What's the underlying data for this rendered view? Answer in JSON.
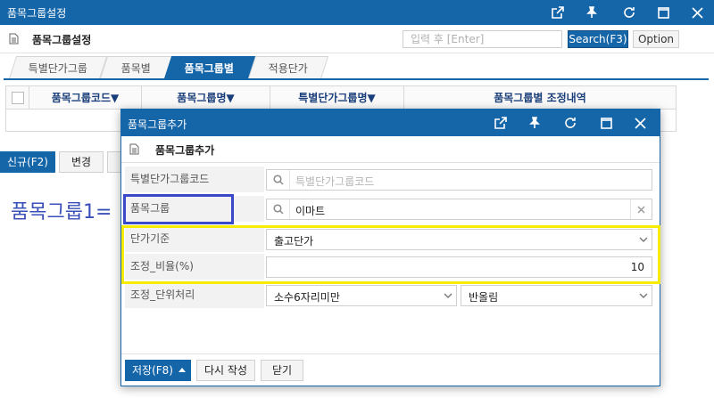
{
  "window": {
    "title": "품목그룹설정",
    "header_title": "품목그룹설정",
    "search": {
      "placeholder": "입력 후 [Enter]",
      "value": ""
    },
    "search_button": "Search(F3)",
    "option_button": "Option"
  },
  "tabs": [
    {
      "label": "특별단가그룹",
      "active": false
    },
    {
      "label": "품목별",
      "active": false
    },
    {
      "label": "품목그룹별",
      "active": true
    },
    {
      "label": "적용단가",
      "active": false
    }
  ],
  "grid": {
    "columns": [
      "품목그룹코드▼",
      "품목그룹명▼",
      "특별단가그룹명▼",
      "품목그룹별 조정내역"
    ]
  },
  "main_buttons": {
    "new": "신규(F2)",
    "edit": "변경"
  },
  "overlay_text": "품목그룹1=",
  "modal": {
    "title": "품목그룹추가",
    "header_title": "품목그룹추가",
    "fields": [
      {
        "label": "특별단가그룹코드",
        "placeholder": "특별단가그룹코드",
        "value": ""
      },
      {
        "label": "품목그룹",
        "value": "이마트"
      },
      {
        "label": "단가기준",
        "value": "출고단가"
      },
      {
        "label": "조정_비율(%)",
        "value": "10"
      },
      {
        "label": "조정_단위처리",
        "value": "소수6자리미만",
        "value2": "반올림"
      }
    ],
    "footer": {
      "save": "저장(F8)",
      "rewrite": "다시 작성",
      "close": "닫기"
    }
  },
  "icons": {
    "window_controls": [
      "external-link-icon",
      "pin-icon",
      "refresh-icon",
      "maximize-icon",
      "close-icon"
    ]
  },
  "colors": {
    "accent": "#1565a9",
    "annotation_blue": "#3949c8",
    "annotation_yellow": "#f5ec00"
  }
}
